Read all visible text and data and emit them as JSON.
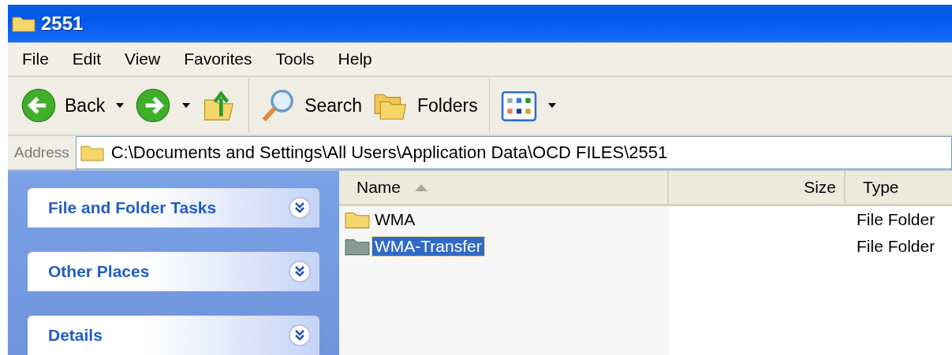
{
  "window": {
    "title": "2551"
  },
  "menu": [
    "File",
    "Edit",
    "View",
    "Favorites",
    "Tools",
    "Help"
  ],
  "toolbar": [
    {
      "kind": "back",
      "label": "Back"
    },
    {
      "kind": "forward"
    },
    {
      "kind": "up"
    },
    {
      "kind": "search",
      "label": "Search"
    },
    {
      "kind": "folders",
      "label": "Folders"
    },
    {
      "kind": "views"
    }
  ],
  "address": {
    "label": "Address",
    "value": "C:\\Documents and Settings\\All Users\\Application Data\\OCD FILES\\2551"
  },
  "sidebar": {
    "panels": [
      {
        "title": "File and Folder Tasks",
        "expanded": false
      },
      {
        "title": "Other Places",
        "expanded": false
      },
      {
        "title": "Details",
        "expanded": false
      }
    ]
  },
  "table": {
    "columns": [
      {
        "label": "Name",
        "sorted": true
      },
      {
        "label": "Size",
        "sorted": false
      },
      {
        "label": "Type",
        "sorted": false
      }
    ],
    "rows": [
      {
        "name": "WMA",
        "type": "File Folder",
        "selected": false
      },
      {
        "name": "WMA-Transfer",
        "type": "File Folder",
        "selected": true
      }
    ]
  }
}
